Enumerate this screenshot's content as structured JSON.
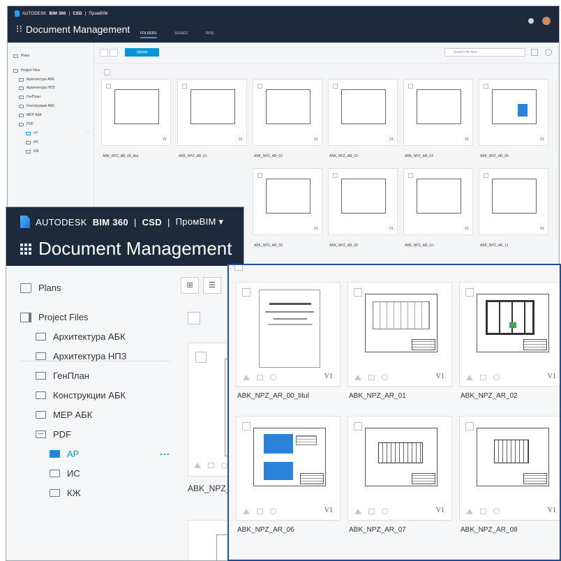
{
  "header": {
    "brand": "AUTODESK",
    "product": "BIM 360",
    "account": "CSD",
    "project": "ПромBIM",
    "title": "Document Management",
    "tabs": [
      "FOLDERS",
      "ISSUES",
      "RFIS"
    ]
  },
  "sidebar": {
    "plans": "Plans",
    "project_files": "Project Files",
    "folders": [
      "Архитектура АБК",
      "Архитектура НПЗ",
      "ГенПлан",
      "Конструкции АБК",
      "MEP АБК",
      "PDF"
    ],
    "pdf_children": [
      "АР",
      "ИС",
      "КЖ"
    ],
    "more": "..."
  },
  "toolbar": {
    "upload_label": "Upload",
    "search_placeholder": "Search for files"
  },
  "files_row1": [
    {
      "name": "ABK_NPZ_AR_00_titul",
      "version": "V1"
    },
    {
      "name": "ABK_NPZ_AR_01",
      "version": "V1"
    },
    {
      "name": "ABK_NPZ_AR_02",
      "version": "V1"
    },
    {
      "name": "ABK_NPZ_AR_03",
      "version": "V1"
    },
    {
      "name": "ABK_NPZ_AR_04",
      "version": "V1"
    },
    {
      "name": "ABK_NPZ_AR_05",
      "version": "V1"
    }
  ],
  "files_row2": [
    {
      "name": "ABK_NPZ_AR_06",
      "version": "V1"
    },
    {
      "name": "ABK_NPZ_AR_07",
      "version": "V1"
    },
    {
      "name": "ABK_NPZ_AR_08",
      "version": "V1"
    },
    {
      "name": "ABK_NPZ_AR_09",
      "version": "V1"
    },
    {
      "name": "ABK_NPZ_AR_10",
      "version": "V1"
    },
    {
      "name": "ABK_NPZ_AR_11",
      "version": "V1"
    }
  ],
  "mid_partial_name": "ABK_NPZ_A",
  "colors": {
    "topbar": "#1c2a3c",
    "accent": "#0696d7",
    "active_folder": "#0696d7"
  }
}
